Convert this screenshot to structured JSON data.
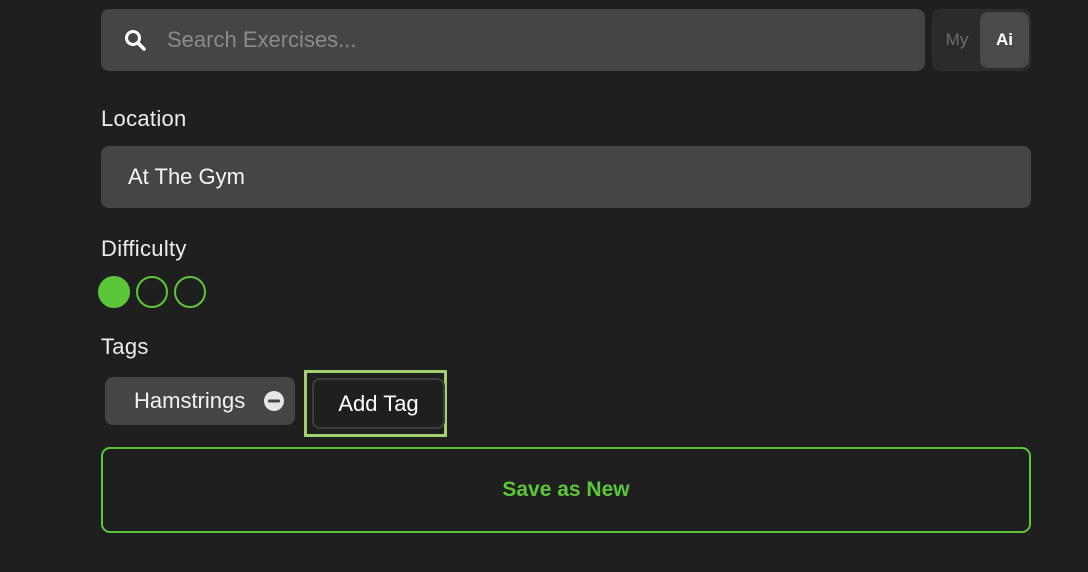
{
  "search": {
    "placeholder": "Search Exercises...",
    "value": "",
    "icon": "search-icon"
  },
  "source_toggle": {
    "options": [
      "My",
      "Ai"
    ],
    "selected": "Ai"
  },
  "location": {
    "label": "Location",
    "value": "At The Gym"
  },
  "difficulty": {
    "label": "Difficulty",
    "level": 1,
    "max": 3,
    "color": "#5cc63a"
  },
  "tags": {
    "label": "Tags",
    "items": [
      {
        "label": "Hamstrings",
        "icon": "remove-icon"
      }
    ],
    "add_label": "Add Tag"
  },
  "actions": {
    "save_label": "Save as New",
    "accent_color": "#5cc63a"
  }
}
